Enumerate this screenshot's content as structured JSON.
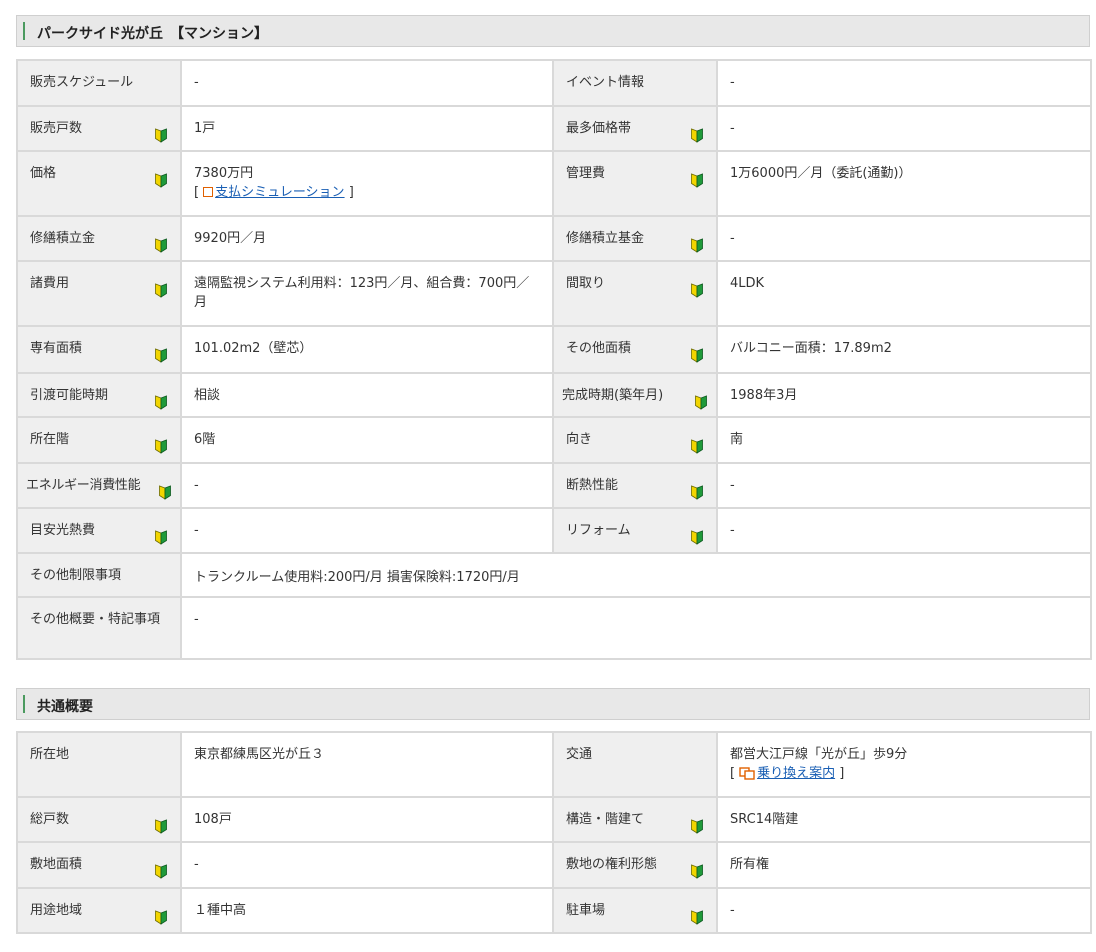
{
  "property": {
    "title": "パークサイド光が丘　【マンション】",
    "rows": [
      {
        "l1": "販売スケジュール",
        "v1": "-",
        "l2": "イベント情報",
        "v2": "-",
        "b1": false,
        "b2": false
      },
      {
        "l1": "販売戸数",
        "v1": "1戸",
        "l2": "最多価格帯",
        "v2": "-",
        "b1": true,
        "b2": true
      },
      {
        "l1": "価格",
        "v1": "7380万円",
        "l2": "管理費",
        "v2": "1万6000円／月（委託(通勤)）",
        "b1": true,
        "b2": true
      },
      {
        "l1": "修繕積立金",
        "v1": "9920円／月",
        "l2": "修繕積立基金",
        "v2": "-",
        "b1": true,
        "b2": true
      },
      {
        "l1": "諸費用",
        "v1": "遠隔監視システム利用料：123円／月、組合費：700円／月",
        "l2": "間取り",
        "v2": "4LDK",
        "b1": true,
        "b2": true
      },
      {
        "l1": "専有面積",
        "v1": "101.02m2（壁芯）",
        "l2": "その他面積",
        "v2": "バルコニー面積：17.89m2",
        "b1": true,
        "b2": true
      },
      {
        "l1": "引渡可能時期",
        "v1": "相談",
        "l2": "完成時期(築年月)",
        "v2": "1988年3月",
        "b1": true,
        "b2": true
      },
      {
        "l1": "所在階",
        "v1": "6階",
        "l2": "向き",
        "v2": "南",
        "b1": true,
        "b2": true
      },
      {
        "l1": "エネルギー消費性能",
        "v1": "-",
        "l2": "断熱性能",
        "v2": "-",
        "b1": true,
        "b2": true
      },
      {
        "l1": "目安光熱費",
        "v1": "-",
        "l2": "リフォーム",
        "v2": "-",
        "b1": true,
        "b2": true
      }
    ],
    "payment_link": "支払シミュレーション",
    "other_restrictions_label": "その他制限事項",
    "other_restrictions_value": "トランクルーム使用料:200円/月 損害保険料:1720円/月",
    "other_notes_label": "その他概要・特記事項",
    "other_notes_value": "-"
  },
  "common": {
    "title": "共通概要",
    "address_label": "所在地",
    "address_value": "東京都練馬区光が丘３",
    "access_label": "交通",
    "access_value": "都営大江戸線「光が丘」歩9分",
    "transfer_link": "乗り換え案内",
    "rows": [
      {
        "l1": "総戸数",
        "v1": "108戸",
        "l2": "構造・階建て",
        "v2": "SRC14階建"
      },
      {
        "l1": "敷地面積",
        "v1": "-",
        "l2": "敷地の権利形態",
        "v2": "所有権"
      },
      {
        "l1": "用途地域",
        "v1": "１種中高",
        "l2": "駐車場",
        "v2": "-"
      }
    ]
  },
  "colors": {
    "accent": "#4b9a5f",
    "link": "#1a5fb4",
    "header_bg": "#efefef",
    "border": "#d9d9d9"
  },
  "icons": {
    "beginner": "beginner-mark-icon",
    "simulation": "square-outline-icon",
    "transfer": "train-transfer-icon"
  }
}
